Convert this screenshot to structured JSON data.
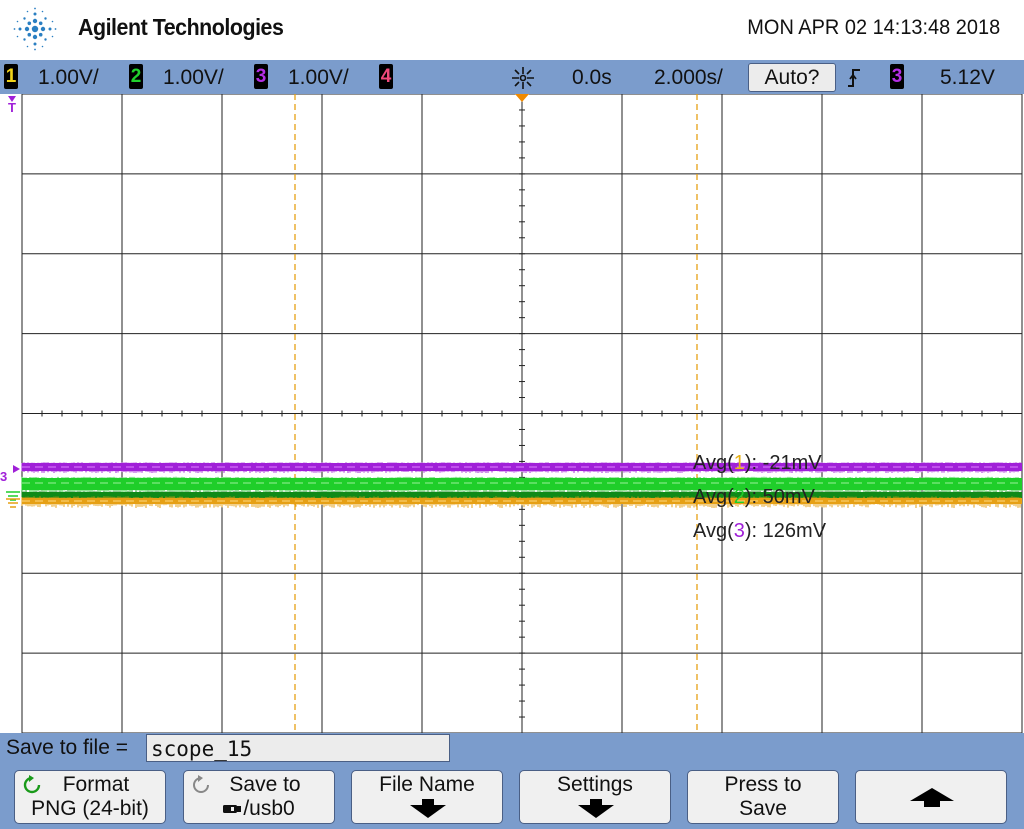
{
  "header": {
    "brand": "Agilent Technologies",
    "datetime": "MON APR 02 14:13:48 2018"
  },
  "status_bar": {
    "channels": [
      {
        "number": "1",
        "scale": "1.00V/",
        "color": "#f1d31a"
      },
      {
        "number": "2",
        "scale": "1.00V/",
        "color": "#21d12d"
      },
      {
        "number": "3",
        "scale": "1.00V/",
        "color": "#b52ee5"
      },
      {
        "number": "4",
        "scale": "",
        "color": "#f04a7b"
      }
    ],
    "time_delay": "0.0s",
    "time_scale": "2.000s/",
    "trigger_mode": "Auto?",
    "trigger_icon": "rising-edge-icon",
    "trigger_source": "3",
    "trigger_level": "5.12V"
  },
  "waveform": {
    "ch1_color": "#e6a015",
    "ch2_color": "#1fce2a",
    "ch3_color": "#a020d8",
    "ch3_marker": "3",
    "trigger_marker": "T"
  },
  "measurements": [
    {
      "prefix": "Avg(",
      "channel": "1",
      "suffix": "): -21mV",
      "color": "#e6b015"
    },
    {
      "prefix": "Avg(",
      "channel": "2",
      "suffix": "): 50mV",
      "color": "#1fce2a"
    },
    {
      "prefix": "Avg(",
      "channel": "3",
      "suffix": "): 126mV",
      "color": "#a020d8"
    }
  ],
  "save_panel": {
    "label": "Save to file =",
    "filename": "scope_15"
  },
  "softkeys": [
    {
      "line1": "Format",
      "line2": "PNG (24-bit)",
      "icon": "cycle-icon"
    },
    {
      "line1": "Save to",
      "line2": "/usb0",
      "icon": "cycle-icon"
    },
    {
      "line1": "File Name",
      "line2": "",
      "icon": "down-arrow-icon"
    },
    {
      "line1": "Settings",
      "line2": "",
      "icon": "down-arrow-icon"
    },
    {
      "line1": "Press to",
      "line2": "Save",
      "icon": ""
    },
    {
      "line1": "",
      "line2": "",
      "icon": "up-arrow-icon"
    }
  ]
}
